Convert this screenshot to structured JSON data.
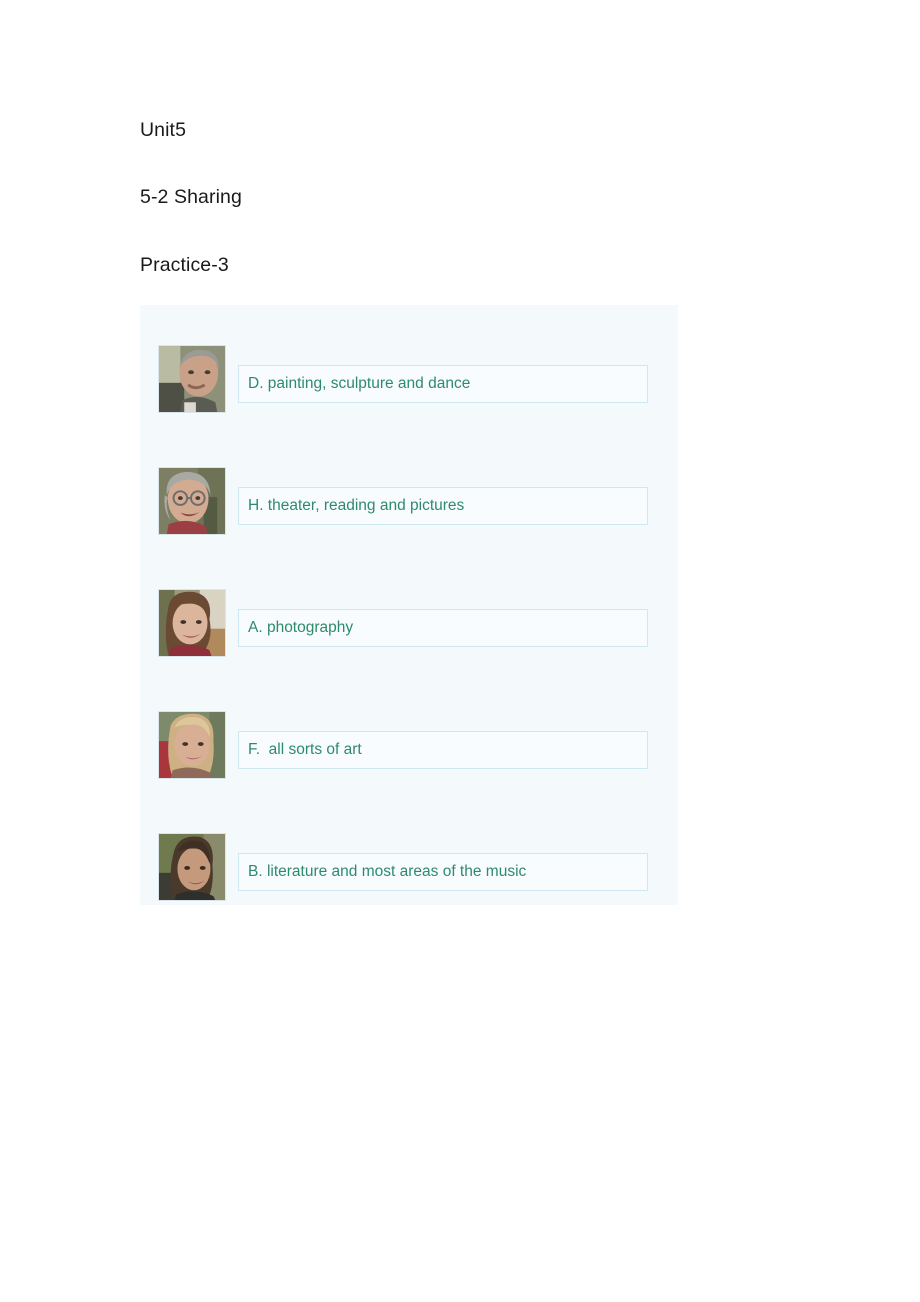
{
  "document": {
    "headings": [
      "Unit5",
      "5-2 Sharing",
      "Practice-3"
    ]
  },
  "exercise": {
    "panel_background": "#f4f9fc",
    "answer_text_color": "#2e8b6a",
    "answer_box_border_color": "#cfe7f3",
    "rows": [
      {
        "thumbnail_alt": "portrait-man-gray-hair",
        "answer": "D. painting, sculpture and dance"
      },
      {
        "thumbnail_alt": "portrait-older-woman-glasses",
        "answer": "H. theater, reading and pictures"
      },
      {
        "thumbnail_alt": "portrait-woman-long-brown-hair",
        "answer": "A. photography"
      },
      {
        "thumbnail_alt": "portrait-blonde-woman",
        "answer": "F.  all sorts of art"
      },
      {
        "thumbnail_alt": "portrait-young-man-dark-hair",
        "answer": "B. literature and most areas of the music"
      }
    ]
  }
}
